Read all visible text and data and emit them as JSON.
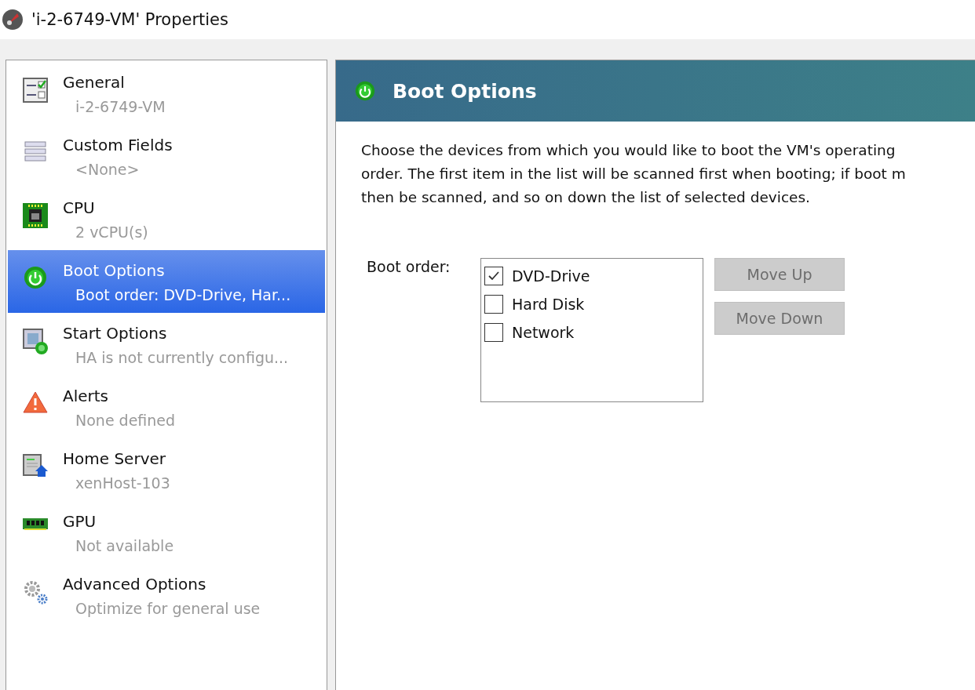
{
  "window": {
    "title": "'i-2-6749-VM' Properties"
  },
  "sidebar": {
    "items": [
      {
        "kind": "general",
        "label": "General",
        "detail": "i-2-6749-VM",
        "selected": false
      },
      {
        "kind": "fields",
        "label": "Custom Fields",
        "detail": "<None>",
        "selected": false
      },
      {
        "kind": "cpu",
        "label": "CPU",
        "detail": "2 vCPU(s)",
        "selected": false
      },
      {
        "kind": "boot",
        "label": "Boot Options",
        "detail": "Boot order: DVD-Drive, Har...",
        "selected": true
      },
      {
        "kind": "start",
        "label": "Start Options",
        "detail": "HA is not currently configu...",
        "selected": false
      },
      {
        "kind": "alert",
        "label": "Alerts",
        "detail": "None defined",
        "selected": false
      },
      {
        "kind": "server",
        "label": "Home Server",
        "detail": "xenHost-103",
        "selected": false
      },
      {
        "kind": "gpu",
        "label": "GPU",
        "detail": "Not available",
        "selected": false
      },
      {
        "kind": "advanced",
        "label": "Advanced Options",
        "detail": "Optimize for general use",
        "selected": false
      }
    ]
  },
  "panel": {
    "title": "Boot Options",
    "description_lines": [
      "Choose the devices from which you would like to boot the VM's operating",
      "order. The first item in the list will be scanned first when booting; if boot m",
      "then be scanned, and so on down the list of selected devices."
    ],
    "boot_order_label": "Boot order:",
    "devices": [
      {
        "label": "DVD-Drive",
        "checked": true
      },
      {
        "label": "Hard Disk",
        "checked": false
      },
      {
        "label": "Network",
        "checked": false
      }
    ],
    "buttons": [
      {
        "label": "Move Up",
        "disabled": true
      },
      {
        "label": "Move Down",
        "disabled": true
      }
    ]
  }
}
